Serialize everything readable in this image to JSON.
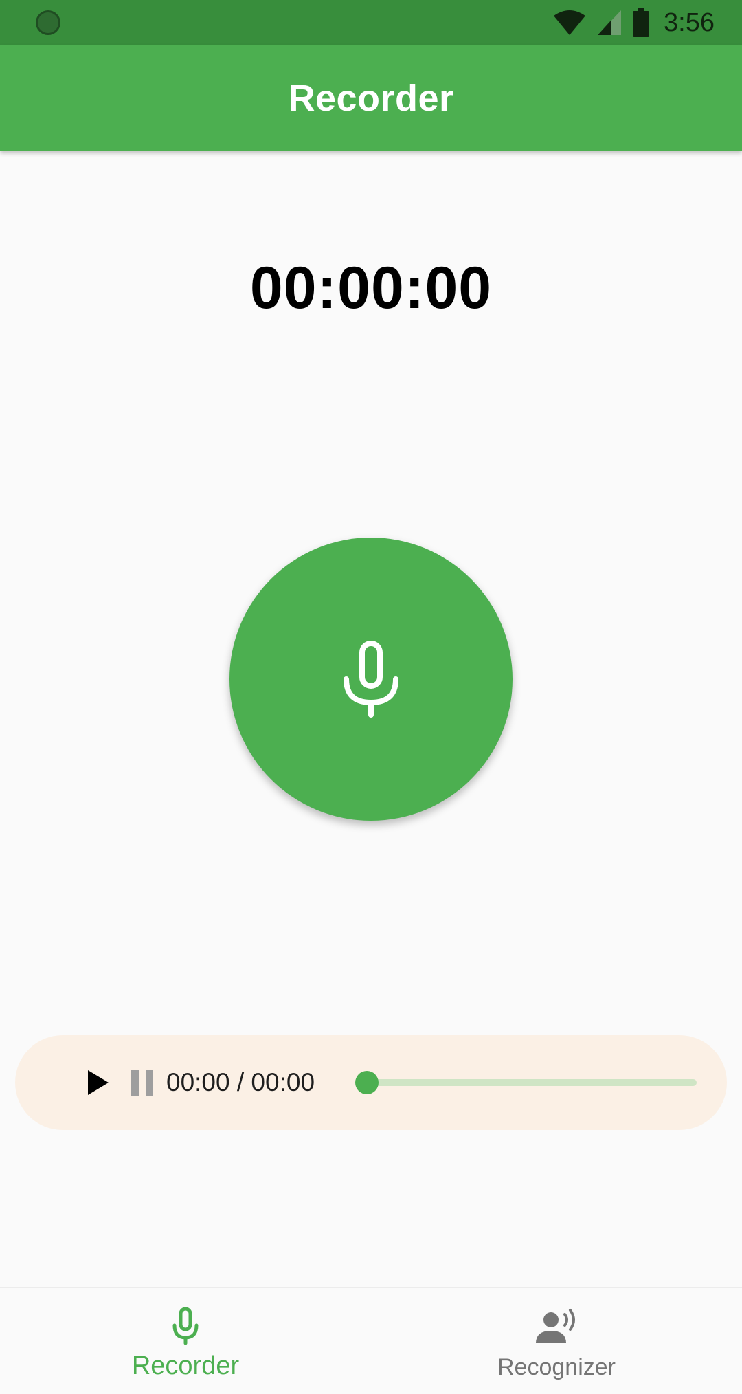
{
  "status_bar": {
    "time": "3:56",
    "icons": [
      "notification-dot-icon",
      "wifi-icon",
      "cell-signal-icon",
      "battery-icon"
    ]
  },
  "app_bar": {
    "title": "Recorder"
  },
  "recorder": {
    "timer": "00:00:00",
    "record_button_icon": "microphone-icon"
  },
  "player": {
    "time_readout": "00:00 / 00:00",
    "progress": 0,
    "play_icon": "play-icon",
    "pause_icon": "pause-icon"
  },
  "bottom_nav": {
    "items": [
      {
        "label": "Recorder",
        "icon": "microphone-icon",
        "active": true
      },
      {
        "label": "Recognizer",
        "icon": "voice-recognition-icon",
        "active": false
      }
    ]
  },
  "colors": {
    "primary": "#4caf50",
    "status_bar": "#388e3c",
    "player_background": "#fbf0e5",
    "seek_track": "#cfe5c5",
    "inactive_nav": "#757575"
  }
}
